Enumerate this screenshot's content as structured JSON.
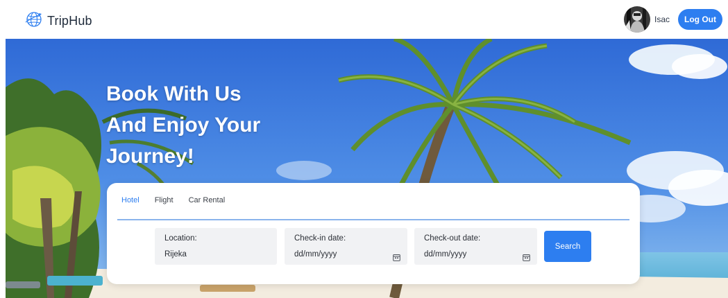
{
  "header": {
    "brand": "TripHub",
    "username": "Isac",
    "logout_label": "Log Out"
  },
  "hero": {
    "headline_lines": [
      "Book With Us",
      "And Enjoy Your",
      "Journey!"
    ]
  },
  "search": {
    "tabs": [
      {
        "label": "Hotel",
        "active": true
      },
      {
        "label": "Flight",
        "active": false
      },
      {
        "label": "Car Rental",
        "active": false
      }
    ],
    "location": {
      "label": "Location:",
      "value": "Rijeka"
    },
    "checkin": {
      "label": "Check-in date:",
      "placeholder": "dd/mm/yyyy"
    },
    "checkout": {
      "label": "Check-out date:",
      "placeholder": "dd/mm/yyyy"
    },
    "search_label": "Search"
  },
  "colors": {
    "accent": "#2d7ef0",
    "sky": "#2f6fd8",
    "field_bg": "#f1f2f4"
  },
  "icons": [
    "globe-icon",
    "calendar-icon"
  ]
}
